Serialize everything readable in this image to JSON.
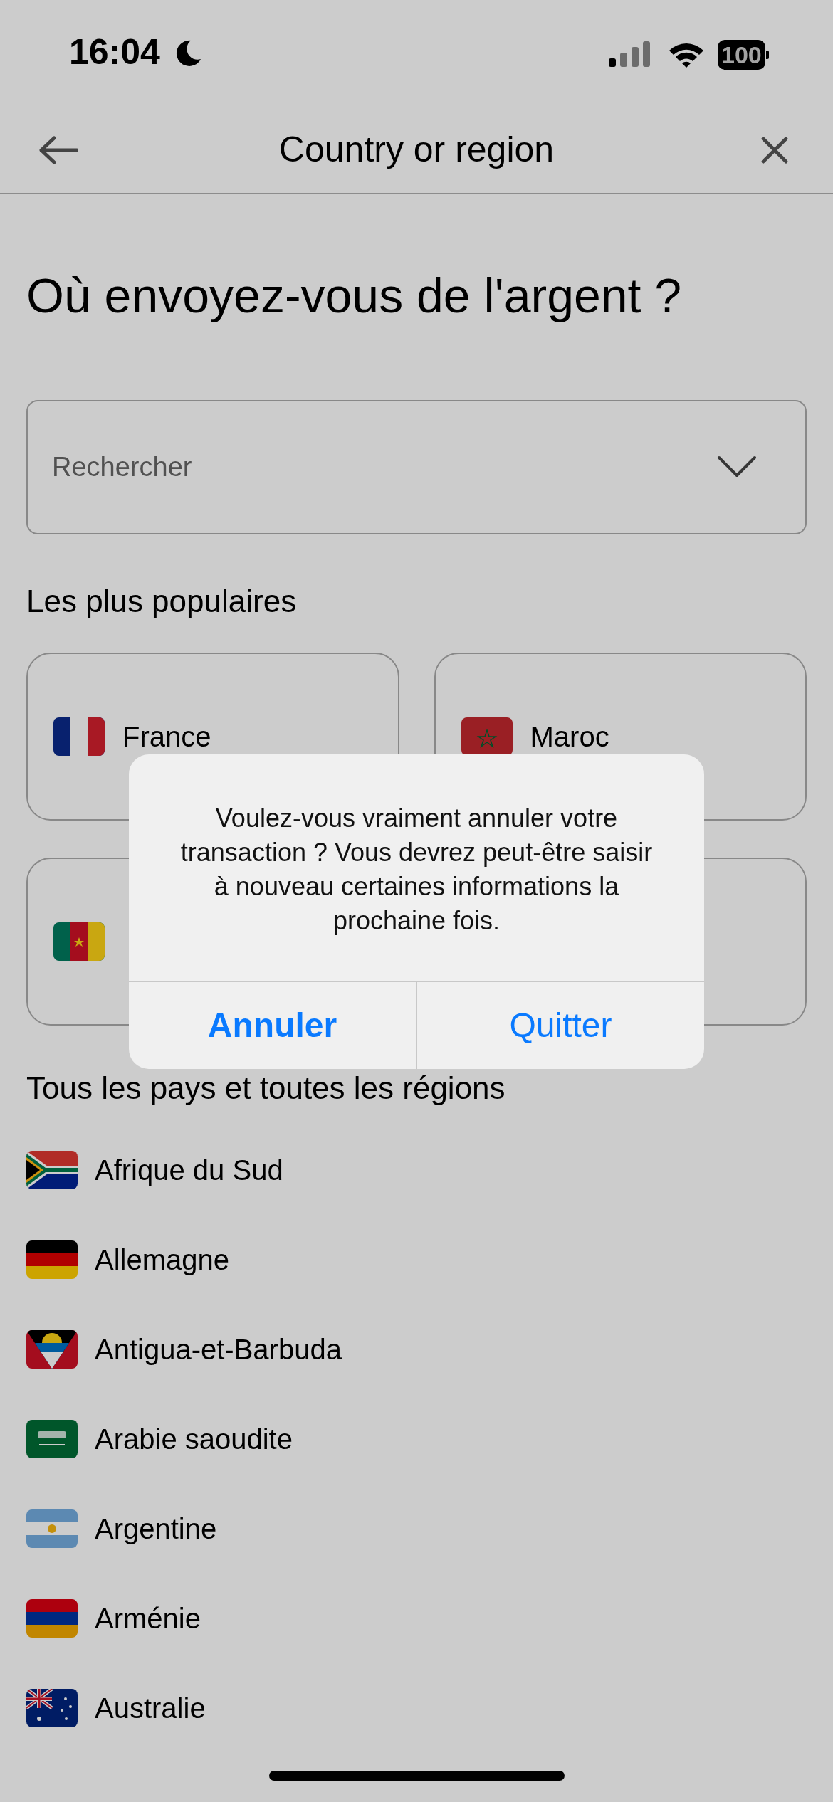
{
  "status_bar": {
    "time": "16:04",
    "focus_moon": true,
    "battery": "100"
  },
  "nav": {
    "title": "Country or region"
  },
  "heading": "Où envoyez-vous de l'argent ?",
  "search": {
    "placeholder": "Rechercher"
  },
  "popular": {
    "title": "Les plus populaires",
    "items": [
      {
        "kind": "country",
        "label": "France"
      },
      {
        "kind": "country",
        "label": "Maroc"
      },
      {
        "kind": "flag_only"
      },
      {
        "kind": "covered"
      }
    ]
  },
  "all": {
    "title": "Tous les pays et toutes les régions",
    "items": [
      {
        "label": "Afrique du Sud"
      },
      {
        "label": "Allemagne"
      },
      {
        "label": "Antigua-et-Barbuda"
      },
      {
        "label": "Arabie saoudite"
      },
      {
        "label": "Argentine"
      },
      {
        "label": "Arménie"
      },
      {
        "label": "Australie"
      }
    ]
  },
  "dialog": {
    "message": "Voulez-vous vraiment annuler votre transaction ? Vous devrez peut-être saisir à nouveau certaines informations la prochaine fois.",
    "buttons": [
      {
        "label": "Annuler",
        "kind": "cancel"
      },
      {
        "label": "Quitter",
        "kind": "default"
      }
    ]
  }
}
